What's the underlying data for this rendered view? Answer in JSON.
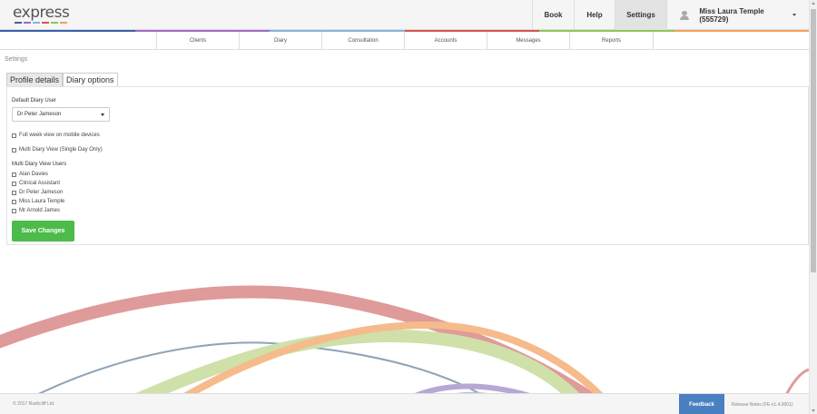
{
  "logo": {
    "text": "express",
    "bar_colors": [
      "#3a60a8",
      "#a06ac0",
      "#86b4de",
      "#d9534f",
      "#8dc55a",
      "#f5a05a"
    ]
  },
  "top_nav": {
    "book": "Book",
    "help": "Help",
    "settings": "Settings",
    "user": "Miss Laura Temple (555729)"
  },
  "strip_colors": [
    "#3a60a8",
    "#a06ac0",
    "#86b4de",
    "#d9534f",
    "#8dc55a",
    "#f5a05a"
  ],
  "sub_nav": {
    "items": [
      "Clients",
      "Diary",
      "Consultation",
      "Accounts",
      "Messages",
      "Reports"
    ]
  },
  "breadcrumb": "Settings",
  "tabs": {
    "profile": "Profile details",
    "diary": "Diary options"
  },
  "form": {
    "default_diary_user_label": "Default Diary User",
    "default_diary_user_value": "Dr Peter Jameson",
    "full_week_label": "Full week view on mobile devices",
    "multi_diary_label": "Multi Diary View (Single Day Only)",
    "multi_users_label": "Multi Diary View Users",
    "users": [
      "Alan Davies",
      "Clinical Assistant",
      "Dr Peter Jameson",
      "Miss Laura Temple",
      "Mr Arnold James"
    ],
    "save_label": "Save Changes"
  },
  "footer": {
    "copyright": "© 2017 Rushcliff Ltd.",
    "feedback": "Feedback",
    "release": "Release Notes (FE-v1.4.0001)"
  }
}
